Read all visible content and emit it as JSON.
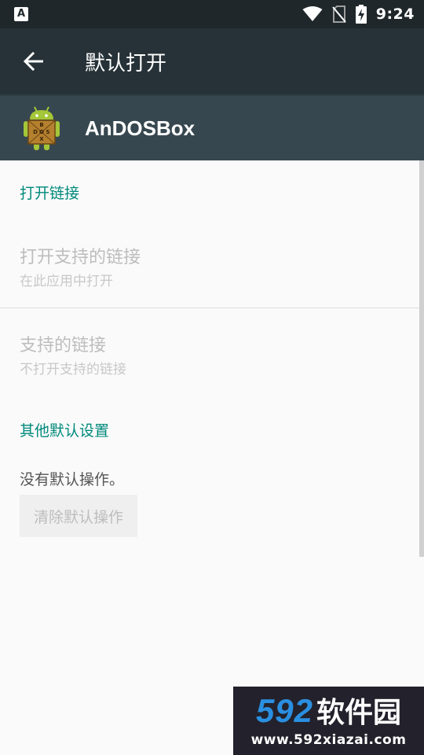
{
  "status_bar": {
    "notification_glyph": "A",
    "time": "9:24",
    "icons": [
      "wifi-icon",
      "no-sim-icon",
      "battery-charging-icon"
    ]
  },
  "toolbar": {
    "title": "默认打开",
    "back_icon": "arrow-back-icon"
  },
  "app": {
    "name": "AnDOSBox",
    "icon_letters": [
      "B",
      "D",
      "O",
      "S",
      "X"
    ]
  },
  "sections": {
    "open_links_header": "打开链接",
    "open_supported": {
      "title": "打开支持的链接",
      "summary": "在此应用中打开"
    },
    "supported_links": {
      "title": "支持的链接",
      "summary": "不打开支持的链接"
    },
    "other_defaults_header": "其他默认设置",
    "no_defaults_text": "没有默认操作。",
    "clear_button_label": "清除默认操作"
  },
  "watermark": {
    "brand_number": "592",
    "brand_text": "软件园",
    "url": "www.592xiazai.com"
  },
  "colors": {
    "toolbar": "#263238",
    "app_header": "#37474f",
    "accent": "#00897b",
    "status_bar": "#1f272b"
  }
}
